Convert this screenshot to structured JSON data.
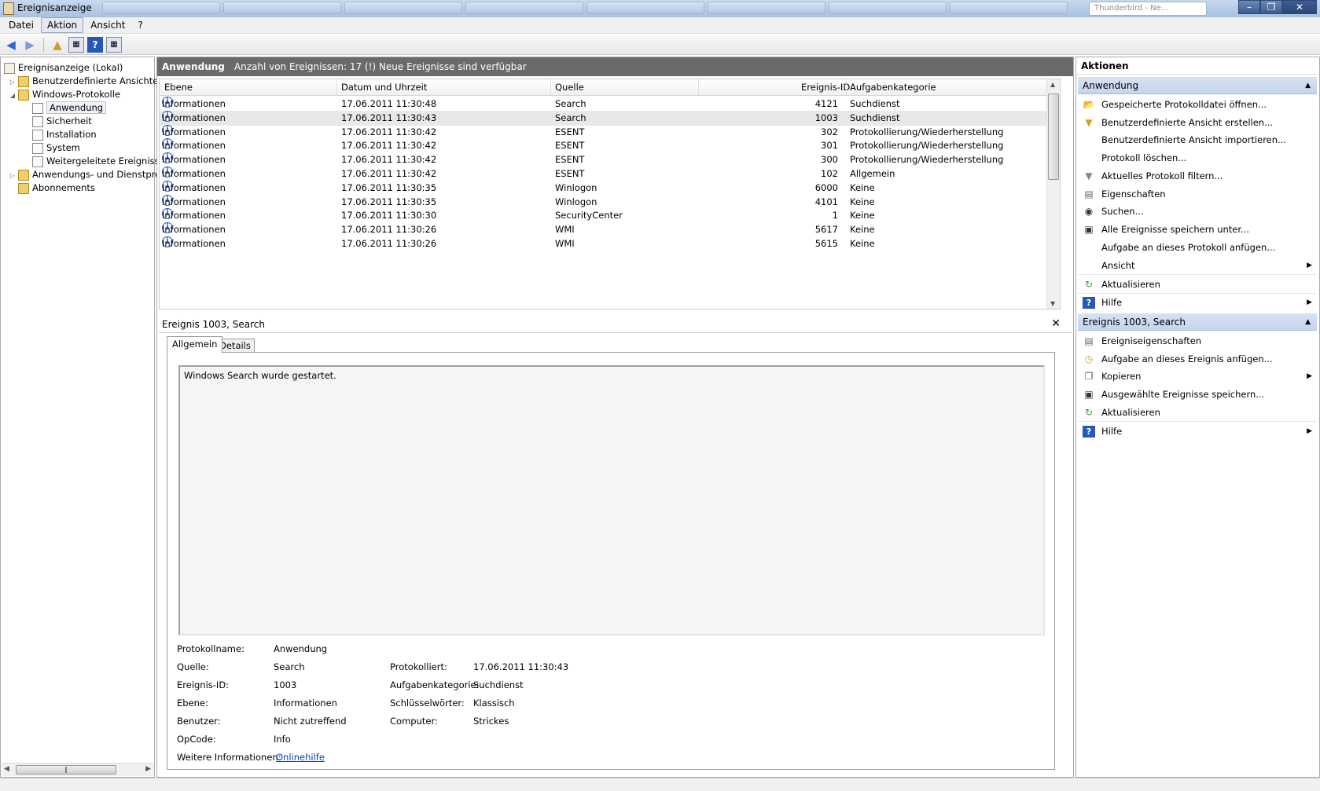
{
  "window": {
    "title": "Ereignisanzeige",
    "active_task": "Thunderbird - Ne..."
  },
  "menu": [
    "Datei",
    "Aktion",
    "Ansicht",
    "?"
  ],
  "tree": {
    "root": "Ereignisanzeige (Lokal)",
    "custom_views": "Benutzerdefinierte Ansichten",
    "windows_logs": "Windows-Protokolle",
    "logs": [
      "Anwendung",
      "Sicherheit",
      "Installation",
      "System",
      "Weitergeleitete Ereignisse"
    ],
    "app_services": "Anwendungs- und Dienstprotokolle",
    "subscriptions": "Abonnements"
  },
  "header": {
    "name": "Anwendung",
    "info": "Anzahl von Ereignissen: 17 (!) Neue Ereignisse sind verfügbar"
  },
  "grid": {
    "columns": [
      "Ebene",
      "Datum und Uhrzeit",
      "Quelle",
      "Ereignis-ID",
      "Aufgabenkategorie"
    ],
    "rows": [
      {
        "level": "Informationen",
        "date": "17.06.2011 11:30:48",
        "source": "Search",
        "id": "4121",
        "cat": "Suchdienst"
      },
      {
        "level": "Informationen",
        "date": "17.06.2011 11:30:43",
        "source": "Search",
        "id": "1003",
        "cat": "Suchdienst"
      },
      {
        "level": "Informationen",
        "date": "17.06.2011 11:30:42",
        "source": "ESENT",
        "id": "302",
        "cat": "Protokollierung/Wiederherstellung"
      },
      {
        "level": "Informationen",
        "date": "17.06.2011 11:30:42",
        "source": "ESENT",
        "id": "301",
        "cat": "Protokollierung/Wiederherstellung"
      },
      {
        "level": "Informationen",
        "date": "17.06.2011 11:30:42",
        "source": "ESENT",
        "id": "300",
        "cat": "Protokollierung/Wiederherstellung"
      },
      {
        "level": "Informationen",
        "date": "17.06.2011 11:30:42",
        "source": "ESENT",
        "id": "102",
        "cat": "Allgemein"
      },
      {
        "level": "Informationen",
        "date": "17.06.2011 11:30:35",
        "source": "Winlogon",
        "id": "6000",
        "cat": "Keine"
      },
      {
        "level": "Informationen",
        "date": "17.06.2011 11:30:35",
        "source": "Winlogon",
        "id": "4101",
        "cat": "Keine"
      },
      {
        "level": "Informationen",
        "date": "17.06.2011 11:30:30",
        "source": "SecurityCenter",
        "id": "1",
        "cat": "Keine"
      },
      {
        "level": "Informationen",
        "date": "17.06.2011 11:30:26",
        "source": "WMI",
        "id": "5617",
        "cat": "Keine"
      },
      {
        "level": "Informationen",
        "date": "17.06.2011 11:30:26",
        "source": "WMI",
        "id": "5615",
        "cat": "Keine"
      }
    ]
  },
  "detail": {
    "title": "Ereignis 1003, Search",
    "tabs": [
      "Allgemein",
      "Details"
    ],
    "message": "Windows Search wurde gestartet.",
    "labels": {
      "logname": "Protokollname:",
      "source": "Quelle:",
      "id": "Ereignis-ID:",
      "level": "Ebene:",
      "user": "Benutzer:",
      "opcode": "OpCode:",
      "more": "Weitere Informationen:",
      "logged": "Protokolliert:",
      "category": "Aufgabenkategorie:",
      "keywords": "Schlüsselwörter:",
      "computer": "Computer:"
    },
    "values": {
      "logname": "Anwendung",
      "source": "Search",
      "id": "1003",
      "level": "Informationen",
      "user": "Nicht zutreffend",
      "opcode": "Info",
      "more": "Onlinehilfe",
      "logged": "17.06.2011 11:30:43",
      "category": "Suchdienst",
      "keywords": "Klassisch",
      "computer": "Strickes"
    }
  },
  "actions": {
    "title": "Aktionen",
    "section1": "Anwendung",
    "items1": [
      "Gespeicherte Protokolldatei öffnen...",
      "Benutzerdefinierte Ansicht erstellen...",
      "Benutzerdefinierte Ansicht importieren...",
      "Protokoll löschen...",
      "Aktuelles Protokoll filtern...",
      "Eigenschaften",
      "Suchen...",
      "Alle Ereignisse speichern unter...",
      "Aufgabe an dieses Protokoll anfügen...",
      "Ansicht",
      "Aktualisieren",
      "Hilfe"
    ],
    "section2": "Ereignis 1003, Search",
    "items2": [
      "Ereigniseigenschaften",
      "Aufgabe an dieses Ereignis anfügen...",
      "Kopieren",
      "Ausgewählte Ereignisse speichern...",
      "Aktualisieren",
      "Hilfe"
    ]
  }
}
